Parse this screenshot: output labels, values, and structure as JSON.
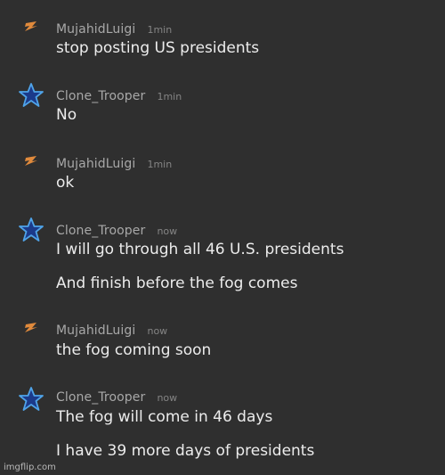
{
  "colors": {
    "background": "#2f2f2f",
    "username": "#a8a8a8",
    "timestamp": "#858585",
    "message_text": "#ececec",
    "mujahid_icon": "#e08a3c",
    "clone_icon_fill": "#1b3a8a",
    "clone_icon_stroke": "#4fa3e8"
  },
  "messages": [
    {
      "user": "MujahidLuigi",
      "time": "1min",
      "icon": "orange-lightning-icon",
      "lines": [
        "stop posting US presidents"
      ]
    },
    {
      "user": "Clone_Trooper",
      "time": "1min",
      "icon": "blue-star-icon",
      "lines": [
        "No"
      ]
    },
    {
      "user": "MujahidLuigi",
      "time": "1min",
      "icon": "orange-lightning-icon",
      "lines": [
        "ok"
      ]
    },
    {
      "user": "Clone_Trooper",
      "time": "now",
      "icon": "blue-star-icon",
      "lines": [
        "I will go through all 46 U.S. presidents",
        "And finish before the fog comes"
      ]
    },
    {
      "user": "MujahidLuigi",
      "time": "now",
      "icon": "orange-lightning-icon",
      "lines": [
        "the fog coming soon"
      ]
    },
    {
      "user": "Clone_Trooper",
      "time": "now",
      "icon": "blue-star-icon",
      "lines": [
        "The fog will come in 46 days",
        "I have 39 more days of presidents"
      ]
    }
  ],
  "watermark": "imgflip.com"
}
